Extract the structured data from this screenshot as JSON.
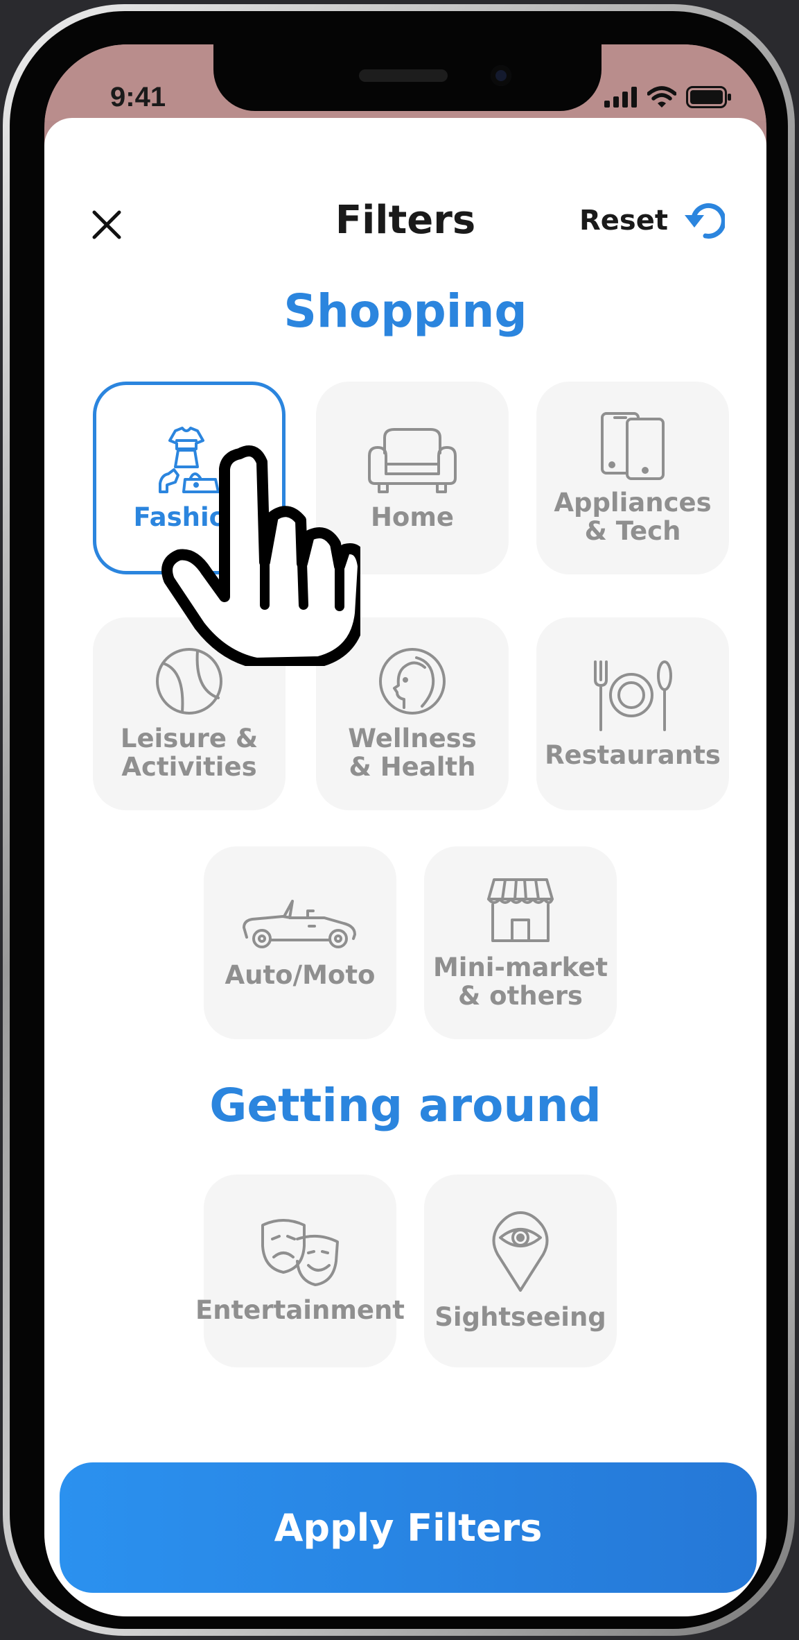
{
  "status_bar": {
    "time": "9:41"
  },
  "header": {
    "title": "Filters",
    "reset_label": "Reset"
  },
  "sections": [
    {
      "title": "Shopping",
      "tiles": [
        {
          "label": "Fashion",
          "icon": "fashion-icon",
          "selected": true
        },
        {
          "label": "Home",
          "icon": "armchair-icon",
          "selected": false
        },
        {
          "label": "Appliances\n& Tech",
          "icon": "devices-icon",
          "selected": false
        },
        {
          "label": "Leisure &\nActivities",
          "icon": "ball-icon",
          "selected": false
        },
        {
          "label": "Wellness\n& Health",
          "icon": "face-icon",
          "selected": false
        },
        {
          "label": "Restaurants",
          "icon": "plate-cutlery-icon",
          "selected": false
        },
        {
          "label": "Auto/Moto",
          "icon": "car-icon",
          "selected": false
        },
        {
          "label": "Mini-market\n& others",
          "icon": "store-icon",
          "selected": false
        }
      ]
    },
    {
      "title": "Getting around",
      "tiles": [
        {
          "label": "Entertainment",
          "icon": "theater-masks-icon",
          "selected": false
        },
        {
          "label": "Sightseeing",
          "icon": "eye-pin-icon",
          "selected": false
        }
      ]
    }
  ],
  "footer": {
    "apply_label": "Apply Filters"
  },
  "colors": {
    "accent": "#2b85de",
    "tile_bg": "#f5f5f5",
    "muted": "#8f8f8f"
  }
}
